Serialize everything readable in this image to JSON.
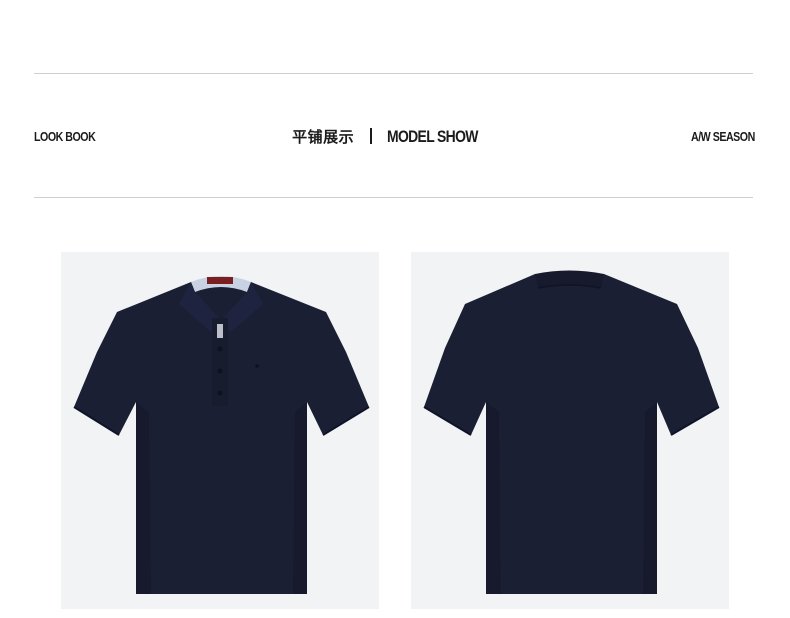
{
  "header": {
    "left_label": "LOOK BOOK",
    "title_cn": "平铺展示",
    "title_en": "MODEL SHOW",
    "right_label": "A/W SEASON"
  },
  "colors": {
    "shirt": "#1a1f33",
    "photo_background": "#f2f3f5",
    "rule": "#cfcfcf",
    "text": "#1b1b1b"
  },
  "gallery": [
    {
      "name": "polo-front-photo",
      "icon": "navy-polo-shirt-front"
    },
    {
      "name": "polo-back-photo",
      "icon": "navy-polo-shirt-back"
    }
  ]
}
